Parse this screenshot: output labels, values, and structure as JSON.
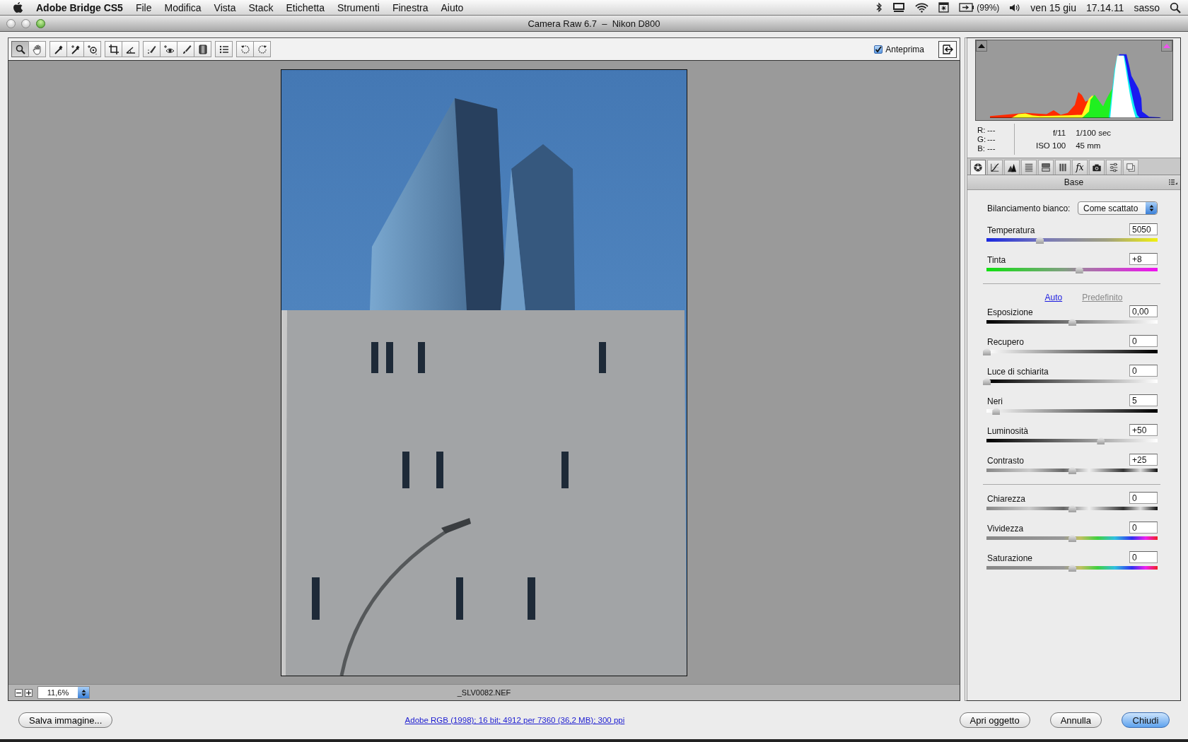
{
  "menu_bar": {
    "app": "Adobe Bridge CS5",
    "items": [
      "File",
      "Modifica",
      "Vista",
      "Stack",
      "Etichetta",
      "Strumenti",
      "Finestra",
      "Aiuto"
    ],
    "battery": "(99%)",
    "date": "ven 15 giu",
    "time": "17.14.11",
    "user": "sasso"
  },
  "window": {
    "title": "Camera Raw 6.7  –  Nikon D800"
  },
  "toolbar": {
    "groups": [
      [
        {
          "kind": "zoom",
          "selected": true
        },
        {
          "kind": "hand",
          "selected": false
        }
      ],
      [
        {
          "kind": "eyedropper",
          "selected": false
        },
        {
          "kind": "sampler",
          "selected": false
        },
        {
          "kind": "target",
          "selected": false
        }
      ],
      [
        {
          "kind": "crop",
          "selected": false
        },
        {
          "kind": "straighten",
          "selected": false
        }
      ],
      [
        {
          "kind": "spot",
          "selected": false
        },
        {
          "kind": "redeye",
          "selected": false
        },
        {
          "kind": "brush",
          "selected": false
        },
        {
          "kind": "gradient",
          "selected": false
        }
      ],
      [
        {
          "kind": "list",
          "selected": false
        }
      ],
      [
        {
          "kind": "rotate-left",
          "selected": false
        },
        {
          "kind": "rotate-right",
          "selected": false
        }
      ]
    ],
    "preview": {
      "label": "Anteprima",
      "checked": true
    }
  },
  "preview": {
    "zoom": "11,6%",
    "filename": "_SLV0082.NEF"
  },
  "readout": {
    "r_label": "R:",
    "r": "---",
    "g_label": "G:",
    "g": "---",
    "b_label": "B:",
    "b": "---",
    "aperture": "f/11",
    "shutter": "1/100 sec",
    "iso": "ISO 100",
    "focal": "45 mm"
  },
  "panel_tabs": [
    {
      "kind": "basic",
      "selected": true
    },
    {
      "kind": "curve",
      "selected": false
    },
    {
      "kind": "detail",
      "selected": false
    },
    {
      "kind": "hsl",
      "selected": false
    },
    {
      "kind": "split",
      "selected": false
    },
    {
      "kind": "lens",
      "selected": false
    },
    {
      "kind": "effects",
      "label": "fx",
      "selected": false
    },
    {
      "kind": "camera",
      "selected": false
    },
    {
      "kind": "presets",
      "selected": false
    },
    {
      "kind": "snapshots",
      "selected": false
    }
  ],
  "panel": {
    "title": "Base",
    "white_balance": {
      "label": "Bilanciamento bianco:",
      "value": "Come scattato"
    },
    "auto_link": "Auto",
    "default_link": "Predefinito",
    "groups": [
      [
        {
          "label": "Temperatura",
          "value": "5050",
          "level": 0.31,
          "kind": "temperature"
        },
        {
          "label": "Tinta",
          "value": "+8",
          "level": 0.54,
          "kind": "tint"
        }
      ],
      [
        {
          "label": "Esposizione",
          "value": "0,00",
          "level": 0.5,
          "kind": "dark-light"
        },
        {
          "label": "Recupero",
          "value": "0",
          "level": 0,
          "kind": "light-dark"
        },
        {
          "label": "Luce di schiarita",
          "value": "0",
          "level": 0,
          "kind": "dark-light"
        },
        {
          "label": "Neri",
          "value": "5",
          "level": 0.055,
          "kind": "light-dark"
        },
        {
          "label": "Luminosità",
          "value": "+50",
          "level": 0.667,
          "kind": "dark-light"
        },
        {
          "label": "Contrasto",
          "value": "+25",
          "level": 0.5,
          "kind": "contrast"
        }
      ],
      [
        {
          "label": "Chiarezza",
          "value": "0",
          "level": 0.5,
          "kind": "contrast"
        },
        {
          "label": "Vividezza",
          "value": "0",
          "level": 0.5,
          "kind": "spectrum"
        },
        {
          "label": "Saturazione",
          "value": "0",
          "level": 0.5,
          "kind": "spectrum"
        }
      ]
    ]
  },
  "footer": {
    "save": "Salva immagine...",
    "workflow": "Adobe RGB (1998); 16 bit; 4912 per 7360 (36,2 MB); 300 ppi",
    "buttons": [
      {
        "label": "Apri oggetto",
        "default": false
      },
      {
        "label": "Annulla",
        "default": false
      },
      {
        "label": "Chiudi",
        "default": true
      }
    ]
  }
}
